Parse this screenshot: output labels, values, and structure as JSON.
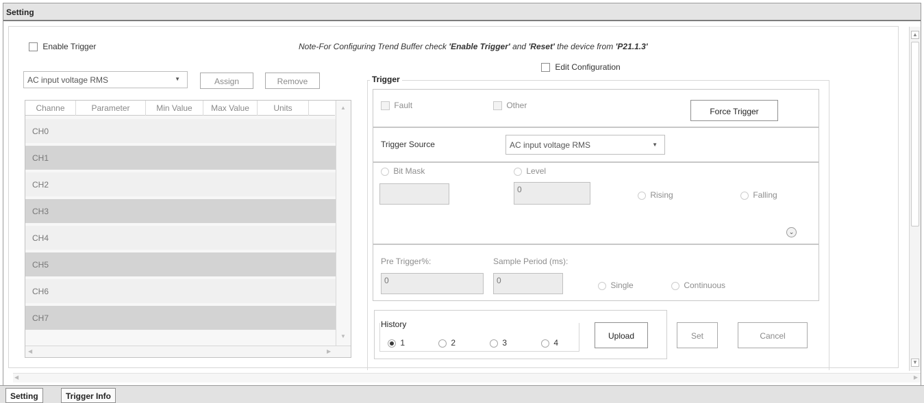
{
  "window": {
    "title": "Setting"
  },
  "enable_trigger": {
    "label": "Enable Trigger",
    "checked": false
  },
  "note": {
    "prefix": "Note-For Configuring Trend Buffer check ",
    "bold1": "'Enable Trigger'",
    "mid": " and ",
    "bold2": "'Reset'",
    "mid2": " the device from ",
    "bold3": "'P21.1.3'"
  },
  "edit_configuration": {
    "label": "Edit Configuration",
    "checked": false
  },
  "parameter_select": {
    "value": "AC input voltage RMS"
  },
  "buttons": {
    "assign": "Assign",
    "remove": "Remove",
    "force_trigger": "Force Trigger",
    "upload": "Upload",
    "set": "Set",
    "cancel": "Cancel"
  },
  "grid": {
    "columns": [
      "Channe",
      "Parameter",
      "Min Value",
      "Max Value",
      "Units"
    ],
    "rows": [
      "CH0",
      "CH1",
      "CH2",
      "CH3",
      "CH4",
      "CH5",
      "CH6",
      "CH7"
    ]
  },
  "trigger": {
    "legend": "Trigger",
    "fault_label": "Fault",
    "other_label": "Other",
    "source_label": "Trigger Source",
    "source_value": "AC input voltage RMS",
    "bitmask_label": "Bit Mask",
    "level_label": "Level",
    "level_value": "0",
    "rising_label": "Rising",
    "falling_label": "Falling",
    "pre_trigger_label": "Pre Trigger%:",
    "pre_trigger_value": "0",
    "sample_period_label": "Sample Period (ms):",
    "sample_period_value": "0",
    "single_label": "Single",
    "continuous_label": "Continuous"
  },
  "history": {
    "legend": "History",
    "options": [
      "1",
      "2",
      "3",
      "4"
    ],
    "selected": "1"
  },
  "tabs": [
    "Setting",
    "Trigger Info"
  ]
}
